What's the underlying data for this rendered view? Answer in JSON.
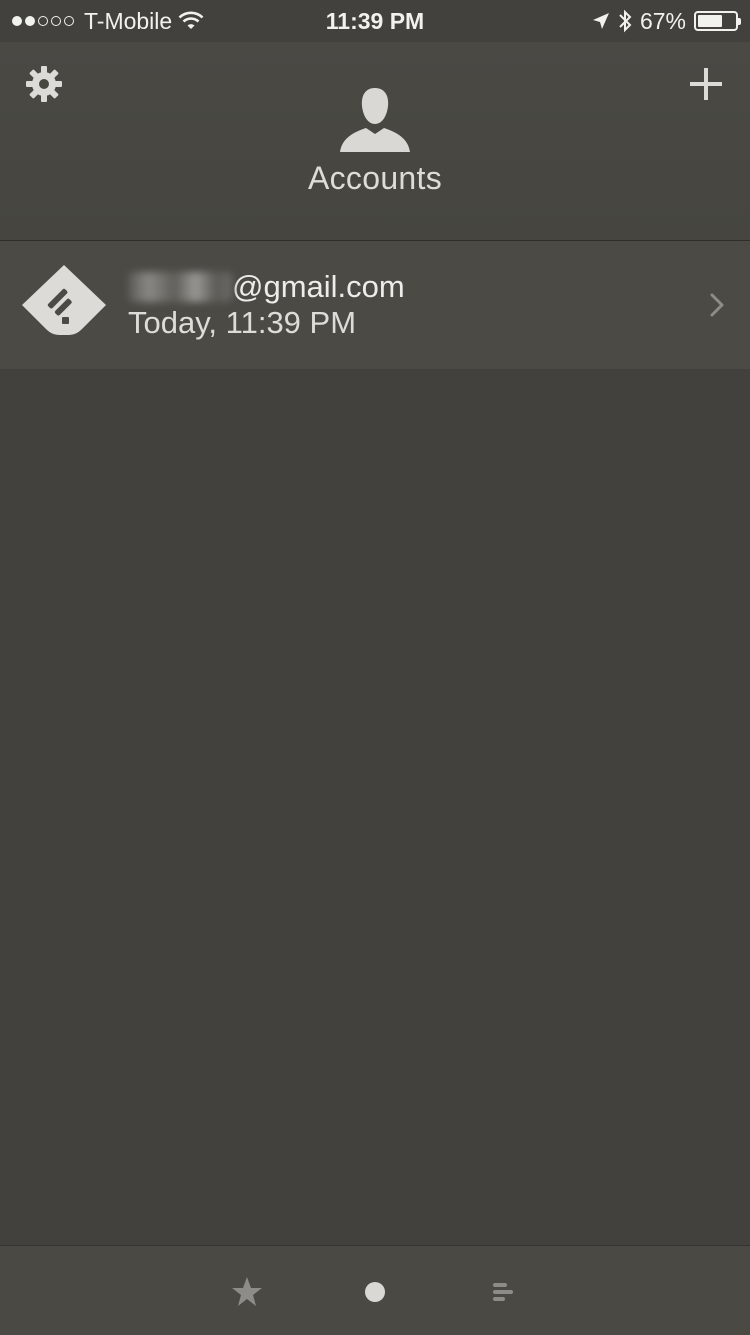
{
  "status_bar": {
    "carrier": "T-Mobile",
    "time": "11:39 PM",
    "battery_percent": "67%",
    "battery_level": 0.67,
    "signal_dots_on": 2,
    "signal_dots_total": 5
  },
  "header": {
    "title": "Accounts",
    "settings_icon": "gear-icon",
    "add_icon": "plus-icon",
    "title_icon": "user-silhouette-icon"
  },
  "accounts": [
    {
      "email_visible": "@gmail.com",
      "last_updated": "Today, 11:39 PM",
      "icon": "feedly-logo-icon"
    }
  ],
  "tab_bar": {
    "items": [
      "star-icon",
      "dot-icon",
      "list-icon"
    ]
  },
  "colors": {
    "background": "#42413d",
    "header": "#48473f",
    "row": "#4b4a45",
    "text": "#e9e9e6",
    "icon": "#d9d8d4"
  }
}
